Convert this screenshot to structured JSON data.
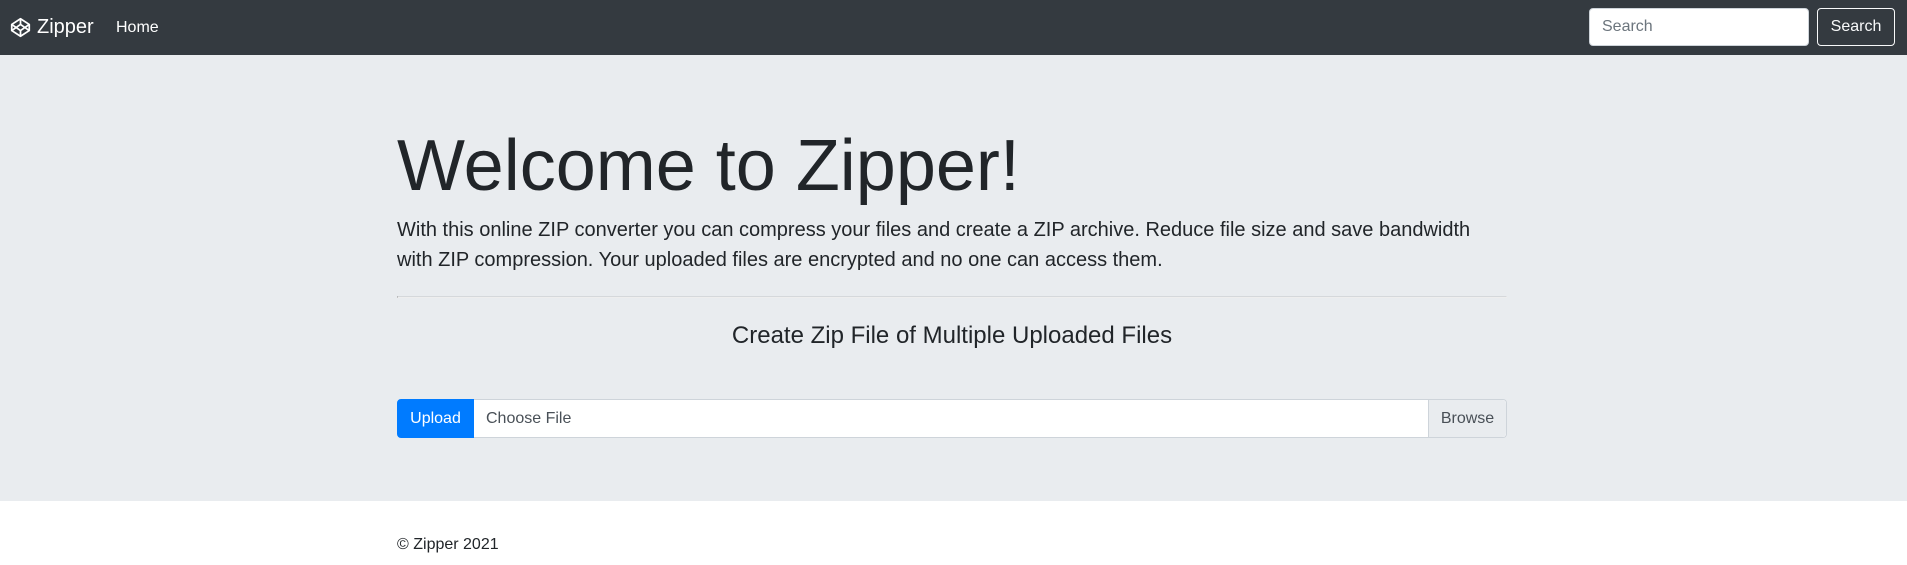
{
  "navbar": {
    "brand_label": "Zipper",
    "brand_icon": "codepen-icon",
    "home_label": "Home",
    "search_placeholder": "Search",
    "search_button_label": "Search"
  },
  "hero": {
    "title": "Welcome to Zipper!",
    "lead": "With this online ZIP converter you can compress your files and create a ZIP archive. Reduce file size and save bandwidth with ZIP compression. Your uploaded files are encrypted and no one can access them.",
    "subheading": "Create Zip File of Multiple Uploaded Files",
    "upload_button_label": "Upload",
    "file_label": "Choose File",
    "browse_label": "Browse"
  },
  "footer": {
    "copyright": "© Zipper 2021"
  },
  "colors": {
    "navbar_bg": "#343a40",
    "jumbotron_bg": "#e9ecef",
    "primary": "#007bff"
  }
}
